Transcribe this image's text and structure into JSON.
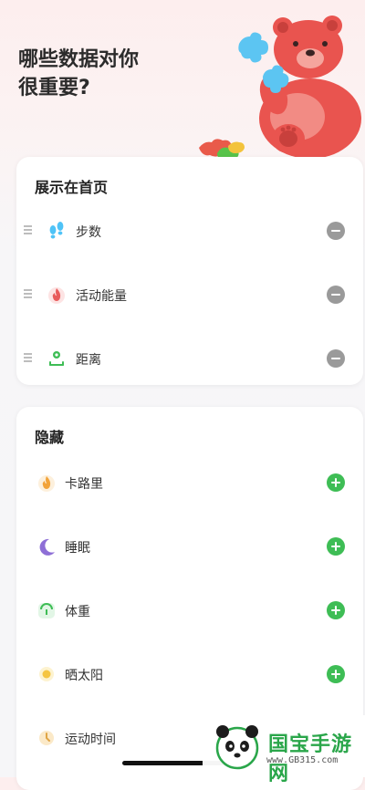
{
  "header": {
    "title_line1": "哪些数据对你",
    "title_line2": "很重要?"
  },
  "home_section": {
    "title": "展示在首页",
    "items": [
      {
        "label": "步数",
        "icon": "footsteps-icon",
        "color": "#4fc3f7"
      },
      {
        "label": "活动能量",
        "icon": "flame-icon",
        "color": "#e85a5a"
      },
      {
        "label": "距离",
        "icon": "distance-icon",
        "color": "#3ebd55"
      }
    ]
  },
  "hidden_section": {
    "title": "隐藏",
    "items": [
      {
        "label": "卡路里",
        "icon": "calorie-flame-icon",
        "color": "#f2a33a"
      },
      {
        "label": "睡眠",
        "icon": "moon-icon",
        "color": "#8e6fd6"
      },
      {
        "label": "体重",
        "icon": "scale-icon",
        "color": "#3ebd55"
      },
      {
        "label": "晒太阳",
        "icon": "sun-icon",
        "color": "#f5c542"
      },
      {
        "label": "运动时间",
        "icon": "clock-icon",
        "color": "#f2c26b"
      }
    ]
  },
  "colors": {
    "add": "#3ebd55",
    "remove": "#9a9a9a",
    "bear": "#e9544f"
  },
  "watermark": {
    "brand": "国宝手游网",
    "url": "www.GB315.com"
  }
}
